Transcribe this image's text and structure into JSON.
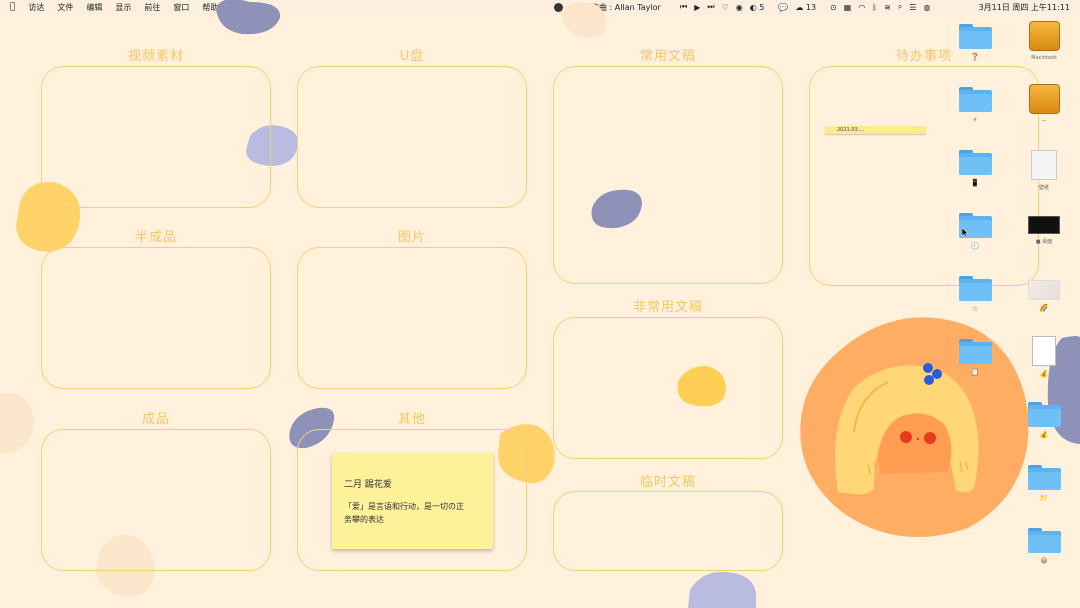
{
  "menubar": {
    "apple_icon": "apple-logo-icon",
    "items": [
      "访达",
      "文件",
      "编辑",
      "显示",
      "前往",
      "窗口",
      "帮助"
    ],
    "now_playing": "作曲 : Allan Taylor",
    "badge_a": "5",
    "badge_b": "13",
    "clock": "3月11日 周四 上午11:11"
  },
  "sections": {
    "video_material": "视频素材",
    "usb_drive": "U盘",
    "common_drafts": "常用文稿",
    "todo": "待办事项",
    "semi_finished": "半成品",
    "images": "图片",
    "uncommon_drafts": "非常用文稿",
    "finished": "成品",
    "other": "其他",
    "temp_drafts": "临时文稿"
  },
  "todo_note": "2021.03....",
  "sticky_note": {
    "title": "二月 踢花爱",
    "body": "「爱」是言语和行动，是一切の正\n务攀的表达"
  },
  "desktop_icons": {
    "col1": [
      {
        "icon": "folder-icon",
        "caption": "❓"
      },
      {
        "icon": "folder-icon",
        "caption": "⚡"
      },
      {
        "icon": "folder-icon",
        "caption": "📱"
      },
      {
        "icon": "folder-icon",
        "caption": "🕗"
      },
      {
        "icon": "folder-icon",
        "caption": "☆"
      },
      {
        "icon": "folder-icon",
        "caption": "📋"
      }
    ],
    "col2": [
      {
        "icon": "drive-icon",
        "caption": "Macintosh"
      },
      {
        "icon": "drive-icon",
        "caption": "—"
      },
      {
        "icon": "image-file-icon",
        "caption": "壁纸"
      },
      {
        "icon": "image-file-icon",
        "caption": "■ 桌面"
      },
      {
        "icon": "image-file-icon",
        "caption": "🌈"
      },
      {
        "icon": "document-icon",
        "caption": "💰"
      },
      {
        "icon": "folder-icon",
        "caption": "💰"
      },
      {
        "icon": "folder-icon",
        "caption": "📁"
      },
      {
        "icon": "folder-icon",
        "caption": "😀"
      }
    ]
  },
  "colors": {
    "background": "#fff1dc",
    "box_border": "#f8cf79",
    "title": "#f7c666",
    "blob_yellow": "#ffd36a",
    "blob_purple": "#8f92b8",
    "blob_orange": "#ffad62"
  }
}
